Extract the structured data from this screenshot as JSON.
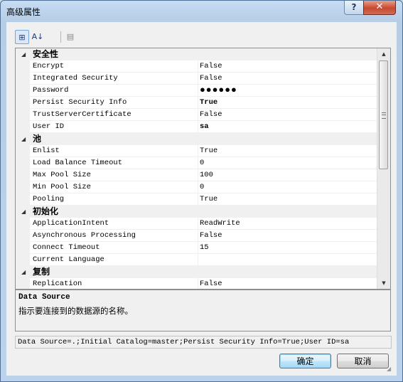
{
  "window": {
    "title": "高级属性",
    "help": "?",
    "close": "✕"
  },
  "toolbar": {
    "categorized": "⊞",
    "alphabetical": "A↓",
    "pages": "▤"
  },
  "grid": {
    "categories": [
      {
        "name": "安全性",
        "props": [
          {
            "name": "Encrypt",
            "value": "False"
          },
          {
            "name": "Integrated Security",
            "value": "False"
          },
          {
            "name": "Password",
            "value": "●●●●●●"
          },
          {
            "name": "Persist Security Info",
            "value": "True"
          },
          {
            "name": "TrustServerCertificate",
            "value": "False"
          },
          {
            "name": "User ID",
            "value": "sa"
          }
        ]
      },
      {
        "name": "池",
        "props": [
          {
            "name": "Enlist",
            "value": "True"
          },
          {
            "name": "Load Balance Timeout",
            "value": "0"
          },
          {
            "name": "Max Pool Size",
            "value": "100"
          },
          {
            "name": "Min Pool Size",
            "value": "0"
          },
          {
            "name": "Pooling",
            "value": "True"
          }
        ]
      },
      {
        "name": "初始化",
        "props": [
          {
            "name": "ApplicationIntent",
            "value": "ReadWrite"
          },
          {
            "name": "Asynchronous Processing",
            "value": "False"
          },
          {
            "name": "Connect Timeout",
            "value": "15"
          },
          {
            "name": "Current Language",
            "value": ""
          }
        ]
      },
      {
        "name": "复制",
        "props": [
          {
            "name": "Replication",
            "value": "False"
          }
        ]
      }
    ]
  },
  "description": {
    "title": "Data Source",
    "text": "指示要连接到的数据源的名称。"
  },
  "connection_string": "Data Source=.;Initial Catalog=master;Persist Security Info=True;User ID=sa",
  "buttons": {
    "ok": "确定",
    "cancel": "取消"
  }
}
